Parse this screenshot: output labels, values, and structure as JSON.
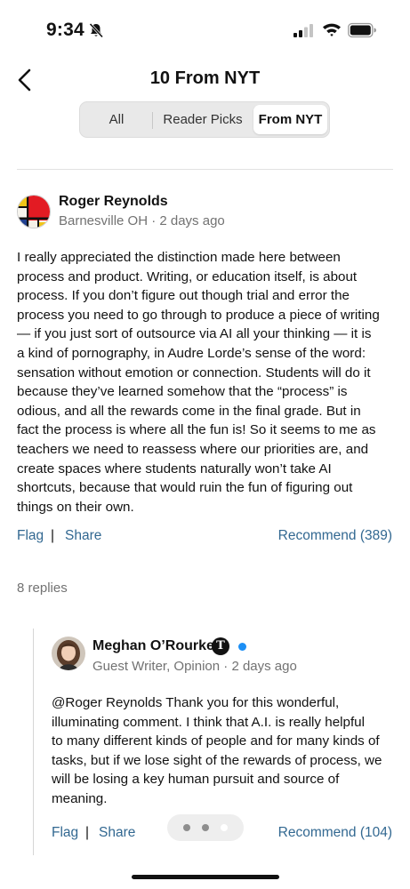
{
  "status_bar": {
    "time": "9:34",
    "icons": [
      "bell-slash-icon",
      "signal-icon",
      "wifi-icon",
      "battery-icon"
    ]
  },
  "nav": {
    "title": "10 From NYT",
    "back_icon": "chevron-left-icon"
  },
  "tabs": {
    "items": [
      {
        "label": "All",
        "selected": false
      },
      {
        "label": "Reader Picks",
        "selected": false
      },
      {
        "label": "From NYT",
        "selected": true
      }
    ]
  },
  "comment": {
    "author": "Roger Reynolds",
    "meta": "Barnesville OH · 2 days ago",
    "body_lines": [
      "I really appreciated the distinction made here between",
      "process and product. Writing, or education itself, is about",
      "process. If you don’t figure out though trial and error the",
      "process you need to go through to produce a piece of writing",
      "— if you just sort of outsource via AI all your thinking — it is",
      "a kind of pornography, in Audre Lorde’s sense of the word:",
      "sensation without emotion or connection. Students will do it",
      "because they’ve learned somehow that the “process” is",
      "odious, and all the rewards come in the final grade. But in",
      "fact the process is where all the fun is! So it seems to me as",
      "teachers we need to reassess where our priorities are, and",
      "create spaces where students naturally won’t take AI",
      "shortcuts, because that would ruin the fun of figuring out",
      "things on their own."
    ],
    "flag_label": "Flag",
    "separator": "|",
    "share_label": "Share",
    "recommend_label": "Recommend (389)"
  },
  "replies": {
    "count_label": "8 replies",
    "reply": {
      "author": "Meghan O’Rourke",
      "badge": "T",
      "meta": "Guest Writer, Opinion · 2 days ago",
      "body_lines": [
        "@Roger Reynolds  Thank you for this wonderful,",
        "illuminating comment. I think that A.I. is really helpful",
        "to many different kinds of people and for many kinds of",
        "tasks, but if we lose sight of the rewards of process, we",
        "will be losing a key human pursuit and source of",
        "meaning."
      ],
      "flag_label": "Flag",
      "separator": "|",
      "share_label": "Share",
      "recommend_label": "Recommend (104)"
    }
  },
  "colors": {
    "link": "#326891",
    "meta": "#727272",
    "verified": "#1c8ff5"
  }
}
